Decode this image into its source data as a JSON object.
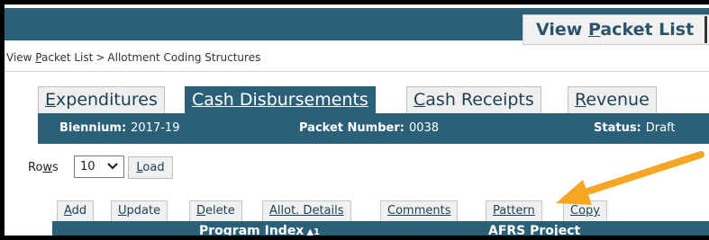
{
  "header": {
    "view_packet_list_prefix": "View ",
    "view_packet_list_u": "P",
    "view_packet_list_suffix": "acket List"
  },
  "breadcrumb": {
    "link_prefix": "View ",
    "link_u": "P",
    "link_suffix": "acket List",
    "separator": ">",
    "current": "Allotment Coding Structures"
  },
  "tabs": [
    {
      "u": "E",
      "rest": "xpenditures"
    },
    {
      "u": "",
      "rest": "Cash Disbursements"
    },
    {
      "u": "C",
      "rest": "ash Receipts"
    },
    {
      "u": "R",
      "rest": "evenue"
    }
  ],
  "info": {
    "biennium_label": "Biennium:",
    "biennium_value": "2017-19",
    "packet_label": "Packet Number:",
    "packet_value": "0038",
    "status_label": "Status:",
    "status_value": "Draft"
  },
  "rows": {
    "label_prefix": "Ro",
    "label_u": "w",
    "label_suffix": "s",
    "selected": "10",
    "chevron_icon": "chevron-down-icon",
    "load_u": "L",
    "load_rest": "oad"
  },
  "actions": [
    {
      "u": "A",
      "rest": "dd"
    },
    {
      "u": "U",
      "rest": "pdate"
    },
    {
      "u": "D",
      "rest": "elete"
    },
    {
      "u": "",
      "rest": "Allot. Details"
    },
    {
      "u": "",
      "rest": "Comments"
    },
    {
      "u": "",
      "rest": "Pattern"
    },
    {
      "u": "",
      "rest": "Copy"
    }
  ],
  "table": {
    "col1_label": "Program Index",
    "col1_sort": "▲1",
    "col2_label": "AFRS Project"
  },
  "colors": {
    "header_blue": "#2b6079",
    "annotation_orange": "#f5a623"
  }
}
